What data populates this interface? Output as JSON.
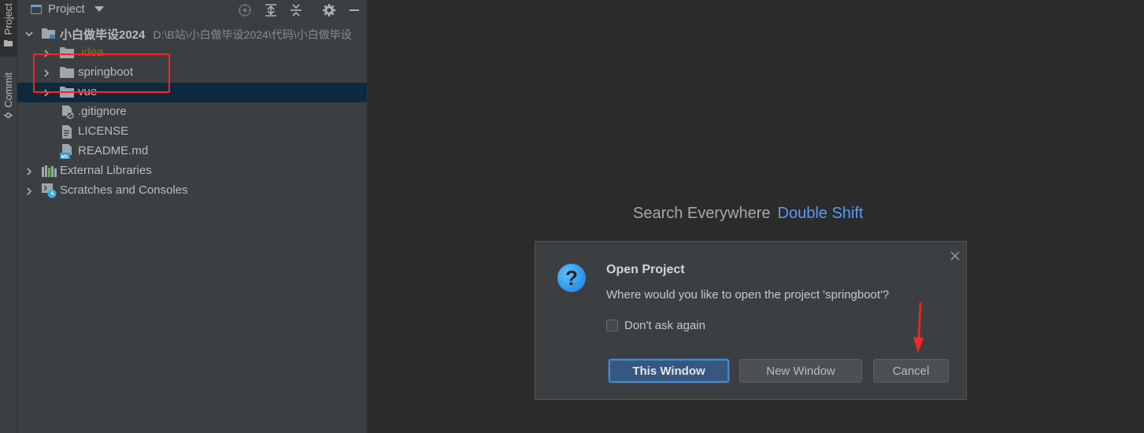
{
  "sidebar_stripe": {
    "project_tab": "Project",
    "commit_tab": "Commit"
  },
  "project_panel": {
    "title": "Project",
    "tree": [
      {
        "label": "小白做毕设2024",
        "path": "D:\\B站\\小白做毕设2024\\代码\\小白做毕设",
        "type": "module-folder",
        "expanded": true,
        "bold": true
      },
      {
        "label": ".idea",
        "type": "folder",
        "color": "#8a6d2f"
      },
      {
        "label": "springboot",
        "type": "folder"
      },
      {
        "label": "vue",
        "type": "folder",
        "selected": true
      },
      {
        "label": ".gitignore",
        "type": "file-ignore"
      },
      {
        "label": "LICENSE",
        "type": "file"
      },
      {
        "label": "README.md",
        "type": "file-md"
      },
      {
        "label": "External Libraries",
        "type": "libraries"
      },
      {
        "label": "Scratches and Consoles",
        "type": "scratches"
      }
    ]
  },
  "editor": {
    "hint_text": "Search Everywhere",
    "hint_key": "Double Shift"
  },
  "dialog": {
    "title": "Open Project",
    "message": "Where would you like to open the project 'springboot'?",
    "checkbox_label": "Don't ask again",
    "checkbox_checked": false,
    "buttons": {
      "this_window": "This Window",
      "new_window": "New Window",
      "cancel": "Cancel"
    }
  },
  "colors": {
    "accent": "#589df6",
    "selection": "#0d293e",
    "annotation_red": "#ff2424"
  }
}
